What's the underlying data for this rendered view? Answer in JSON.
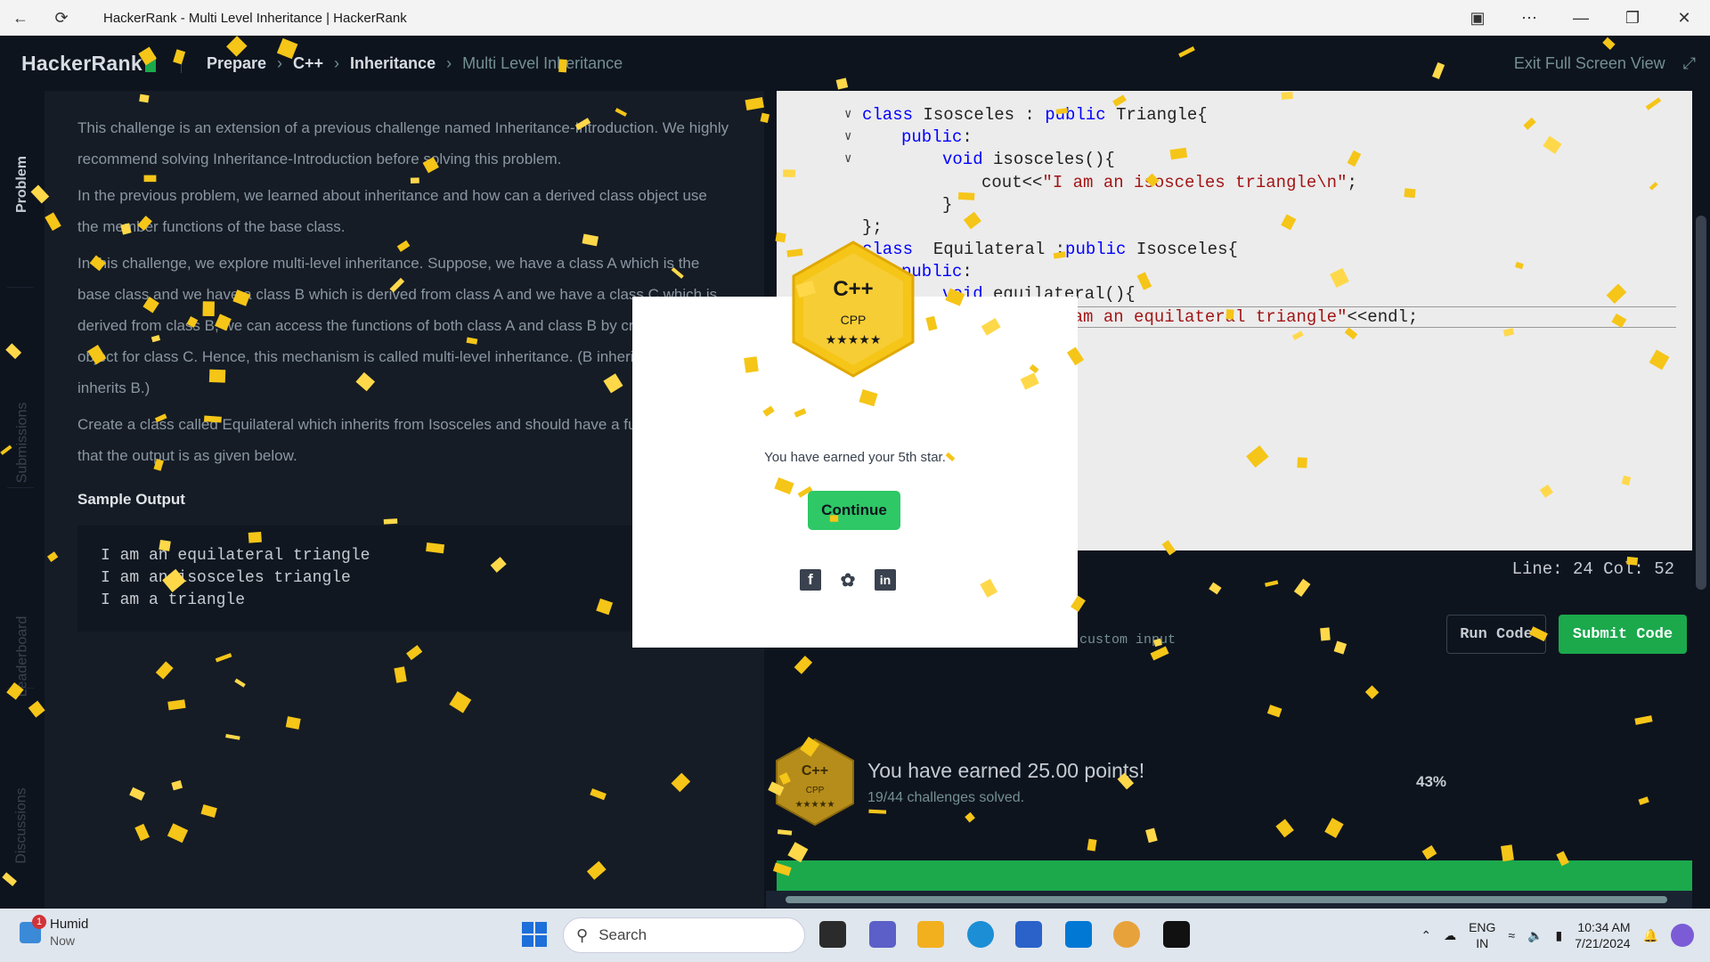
{
  "window": {
    "title": "HackerRank - Multi Level Inheritance | HackerRank",
    "back_icon": "back-arrow-icon",
    "refresh_icon": "refresh-icon"
  },
  "header": {
    "logo": "HackerRank",
    "breadcrumbs": [
      "Prepare",
      "C++",
      "Inheritance",
      "Multi Level Inheritance"
    ],
    "exit_fullscreen": "Exit Full Screen View"
  },
  "sidebar": {
    "tabs": [
      "Problem",
      "Submissions",
      "Leaderboard",
      "Discussions"
    ]
  },
  "problem": {
    "paragraphs": [
      "This challenge is an extension of a previous challenge named Inheritance-Introduction. We highly recommend solving Inheritance-Introduction before solving this problem.",
      "In the previous problem, we learned about inheritance and how can a derived class object use the member functions of the base class.",
      "In this challenge, we explore multi-level inheritance. Suppose, we have a class A which is the base class and we have a class B which is derived from class A and we have a class C which is derived from class B, we can access the functions of both class A and class B by creating an object for class C. Hence, this mechanism is called multi-level inheritance. (B inherits A and C inherits B.)",
      "Create a class called Equilateral which inherits from Isosceles and should have a function such that the output is as given below."
    ],
    "sample_output_title": "Sample Output",
    "sample_output": [
      "I am an equilateral triangle",
      "I am an isosceles triangle",
      "I am a triangle"
    ]
  },
  "editor": {
    "line_col": "Line: 24 Col: 52",
    "run_label": "Run Code",
    "submit_label": "Submit Code",
    "custom_input": "against custom input"
  },
  "result": {
    "points": "You have earned 25.00 points!",
    "solved": "19/44 challenges solved.",
    "percent": "43%",
    "progress": 1.0
  },
  "badge": {
    "language": "C++",
    "label": "CPP",
    "stars": "★★★★★",
    "color": "#f5c518"
  },
  "modal": {
    "message": "You have earned your 5th star.",
    "continue_label": "Continue"
  },
  "taskbar": {
    "weather_title": "Humid",
    "weather_sub": "Now",
    "notification_count": "1",
    "search_placeholder": "Search",
    "lang_top": "ENG",
    "lang_bottom": "IN",
    "time": "10:34 AM",
    "date": "7/21/2024"
  }
}
